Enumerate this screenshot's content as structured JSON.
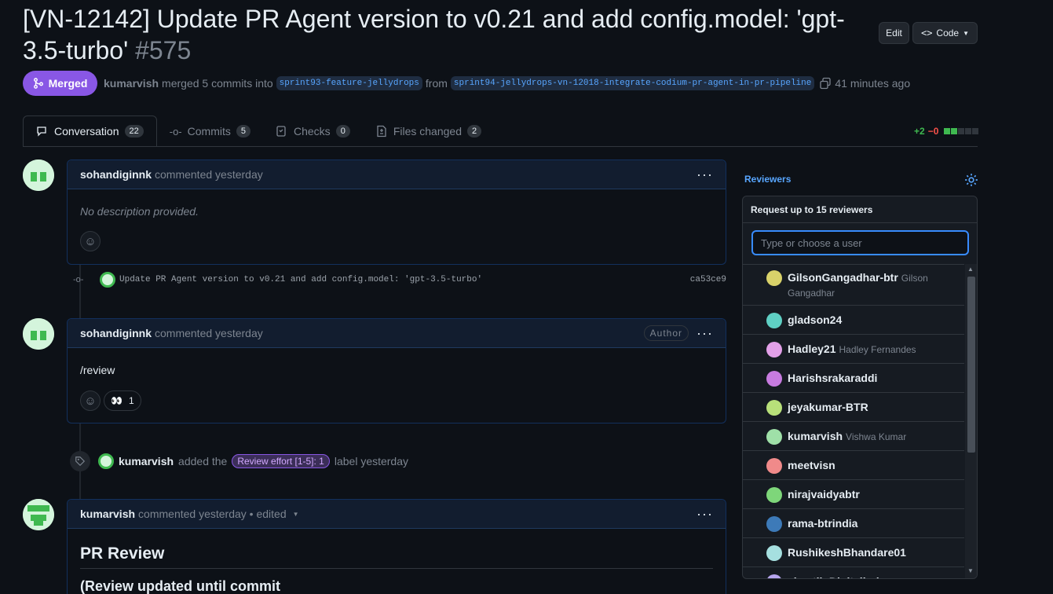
{
  "pr": {
    "title": "[VN-12142] Update PR Agent version to v0.21 and add config.model: 'gpt-3.5-turbo'",
    "number": "#575",
    "edit_label": "Edit",
    "code_label": "Code",
    "state": "Merged",
    "author": "kumarvish",
    "merge_text": "merged 5 commits into",
    "base_branch": "sprint93-feature-jellydrops",
    "from_text": "from",
    "head_branch": "sprint94-jellydrops-vn-12018-integrate-codium-pr-agent-in-pr-pipeline",
    "time": "41 minutes ago"
  },
  "tabs": [
    {
      "label": "Conversation",
      "count": "22"
    },
    {
      "label": "Commits",
      "count": "5"
    },
    {
      "label": "Checks",
      "count": "0"
    },
    {
      "label": "Files changed",
      "count": "2"
    }
  ],
  "diffstat": {
    "added": "+2",
    "removed": "−0"
  },
  "timeline": {
    "comment1": {
      "author": "sohandiginnk",
      "meta": "commented yesterday",
      "body": "No description provided."
    },
    "commit": {
      "message": "Update PR Agent version to v0.21 and add config.model: 'gpt-3.5-turbo'",
      "sha": "ca53ce9"
    },
    "comment2": {
      "author": "sohandiginnk",
      "meta": "commented yesterday",
      "badge": "Author",
      "body": "/review",
      "reaction_count": "1"
    },
    "label_event": {
      "actor": "kumarvish",
      "text_before": "added the",
      "label": "Review effort [1-5]: 1",
      "text_after": "label yesterday"
    },
    "comment3": {
      "author": "kumarvish",
      "meta": "commented yesterday • edited",
      "heading": "PR Review",
      "partial": "(Review updated until commit"
    }
  },
  "sidebar": {
    "reviewers_label": "Reviewers",
    "popup_title": "Request up to 15 reviewers",
    "search_placeholder": "Type or choose a user",
    "users": [
      {
        "login": "GilsonGangadhar-btr",
        "name": "Gilson Gangadhar",
        "color": "#d9d26a"
      },
      {
        "login": "gladson24",
        "name": "",
        "color": "#5fd0c4"
      },
      {
        "login": "Hadley21",
        "name": "Hadley Fernandes",
        "color": "#e2a0e8"
      },
      {
        "login": "Harishsrakaraddi",
        "name": "",
        "color": "#c77be0"
      },
      {
        "login": "jeyakumar-BTR",
        "name": "",
        "color": "#b8e07a"
      },
      {
        "login": "kumarvish",
        "name": "Vishwa Kumar",
        "color": "#9fe0a8"
      },
      {
        "login": "meetvisn",
        "name": "",
        "color": "#f08a8a"
      },
      {
        "login": "nirajvaidyabtr",
        "name": "",
        "color": "#7ed67a"
      },
      {
        "login": "rama-btrindia",
        "name": "",
        "color": "#3d7ab8"
      },
      {
        "login": "RushikeshBhandare01",
        "name": "",
        "color": "#a6e0e0"
      },
      {
        "login": "shastik-Digitalind",
        "name": "",
        "color": "#b7a6ef"
      }
    ]
  },
  "colors": {
    "merged": "#8957e5",
    "accent": "#58a6ff",
    "bg": "#0d1117"
  }
}
